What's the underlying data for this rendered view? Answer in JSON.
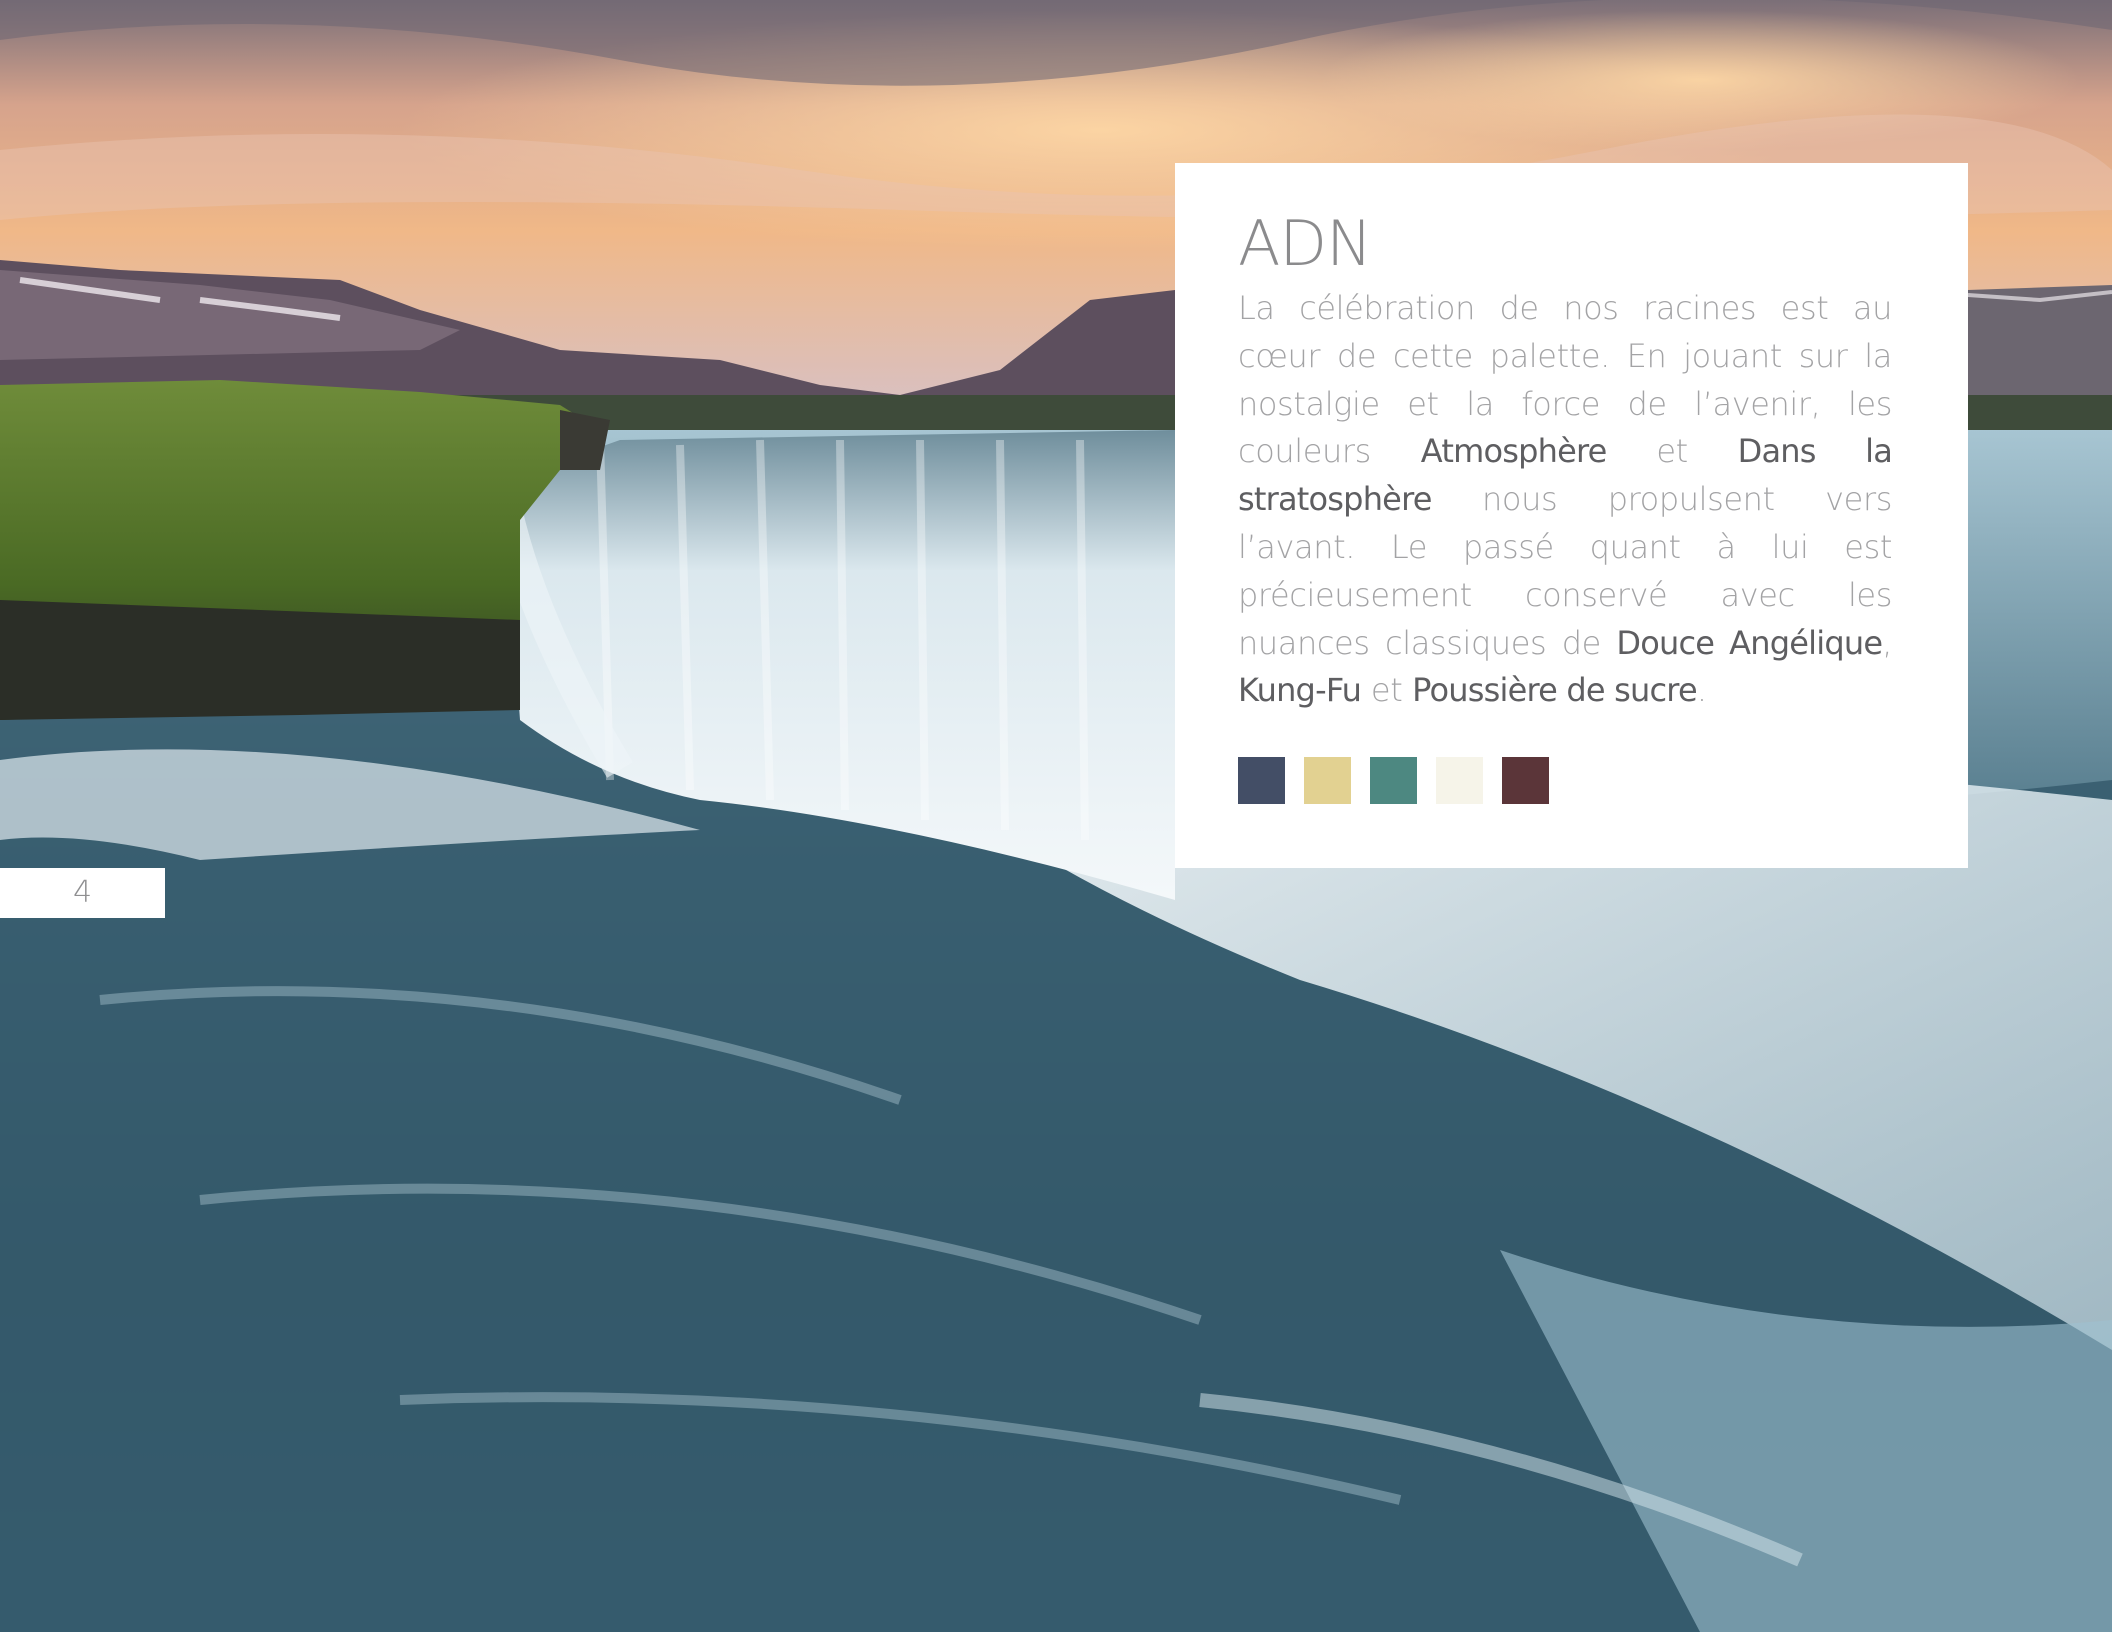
{
  "background": {
    "description_icon": "waterfall-photo",
    "sky_colors": [
      "#c9a7a0",
      "#f3b480",
      "#d9c2c4"
    ],
    "water_colors": [
      "#2c4a5b",
      "#9dc2d2",
      "#e6f1f4"
    ]
  },
  "card": {
    "title": "ADN",
    "body_parts": [
      {
        "text": "La célébration de nos racines est au cœur de cette palette. En jouant sur la nostalgie et la force de l’avenir, les couleurs ",
        "hl": false
      },
      {
        "text": "Atmosphère",
        "hl": true
      },
      {
        "text": " et ",
        "hl": false
      },
      {
        "text": "Dans la stratosphère",
        "hl": true
      },
      {
        "text": " nous propulsent vers l’avant. Le passé quant à lui est précieusement conservé avec les nuances classiques de ",
        "hl": false
      },
      {
        "text": "Douce Angélique",
        "hl": true
      },
      {
        "text": ", ",
        "hl": false
      },
      {
        "text": "Kung-Fu",
        "hl": true
      },
      {
        "text": " et ",
        "hl": false
      },
      {
        "text": "Poussière de sucre",
        "hl": true
      },
      {
        "text": ".",
        "hl": false
      }
    ],
    "swatches": [
      "#434e66",
      "#e2d191",
      "#4d8881",
      "#f6f4e9",
      "#5b3539"
    ]
  },
  "page_number": "4"
}
